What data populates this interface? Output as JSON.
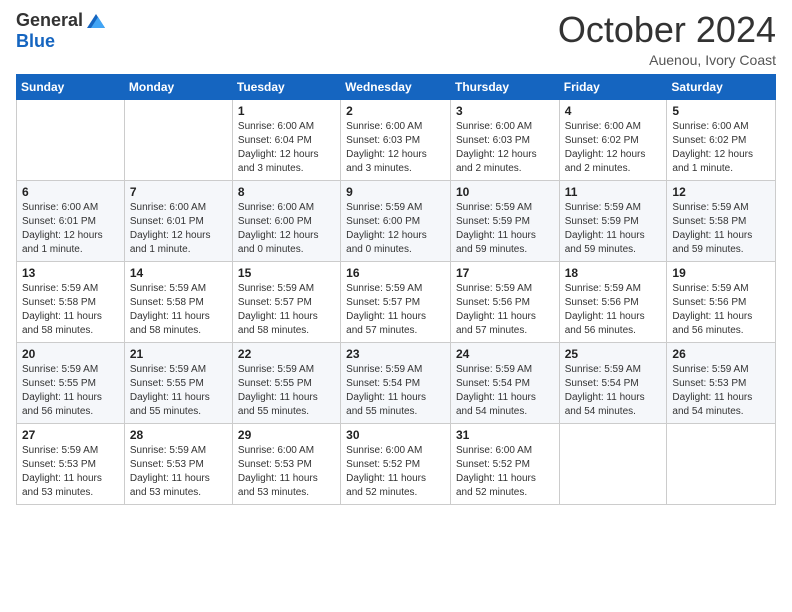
{
  "header": {
    "logo_general": "General",
    "logo_blue": "Blue",
    "month": "October 2024",
    "location": "Auenou, Ivory Coast"
  },
  "days_of_week": [
    "Sunday",
    "Monday",
    "Tuesday",
    "Wednesday",
    "Thursday",
    "Friday",
    "Saturday"
  ],
  "weeks": [
    [
      {
        "day": "",
        "info": ""
      },
      {
        "day": "",
        "info": ""
      },
      {
        "day": "1",
        "info": "Sunrise: 6:00 AM\nSunset: 6:04 PM\nDaylight: 12 hours\nand 3 minutes."
      },
      {
        "day": "2",
        "info": "Sunrise: 6:00 AM\nSunset: 6:03 PM\nDaylight: 12 hours\nand 3 minutes."
      },
      {
        "day": "3",
        "info": "Sunrise: 6:00 AM\nSunset: 6:03 PM\nDaylight: 12 hours\nand 2 minutes."
      },
      {
        "day": "4",
        "info": "Sunrise: 6:00 AM\nSunset: 6:02 PM\nDaylight: 12 hours\nand 2 minutes."
      },
      {
        "day": "5",
        "info": "Sunrise: 6:00 AM\nSunset: 6:02 PM\nDaylight: 12 hours\nand 1 minute."
      }
    ],
    [
      {
        "day": "6",
        "info": "Sunrise: 6:00 AM\nSunset: 6:01 PM\nDaylight: 12 hours\nand 1 minute."
      },
      {
        "day": "7",
        "info": "Sunrise: 6:00 AM\nSunset: 6:01 PM\nDaylight: 12 hours\nand 1 minute."
      },
      {
        "day": "8",
        "info": "Sunrise: 6:00 AM\nSunset: 6:00 PM\nDaylight: 12 hours\nand 0 minutes."
      },
      {
        "day": "9",
        "info": "Sunrise: 5:59 AM\nSunset: 6:00 PM\nDaylight: 12 hours\nand 0 minutes."
      },
      {
        "day": "10",
        "info": "Sunrise: 5:59 AM\nSunset: 5:59 PM\nDaylight: 11 hours\nand 59 minutes."
      },
      {
        "day": "11",
        "info": "Sunrise: 5:59 AM\nSunset: 5:59 PM\nDaylight: 11 hours\nand 59 minutes."
      },
      {
        "day": "12",
        "info": "Sunrise: 5:59 AM\nSunset: 5:58 PM\nDaylight: 11 hours\nand 59 minutes."
      }
    ],
    [
      {
        "day": "13",
        "info": "Sunrise: 5:59 AM\nSunset: 5:58 PM\nDaylight: 11 hours\nand 58 minutes."
      },
      {
        "day": "14",
        "info": "Sunrise: 5:59 AM\nSunset: 5:58 PM\nDaylight: 11 hours\nand 58 minutes."
      },
      {
        "day": "15",
        "info": "Sunrise: 5:59 AM\nSunset: 5:57 PM\nDaylight: 11 hours\nand 58 minutes."
      },
      {
        "day": "16",
        "info": "Sunrise: 5:59 AM\nSunset: 5:57 PM\nDaylight: 11 hours\nand 57 minutes."
      },
      {
        "day": "17",
        "info": "Sunrise: 5:59 AM\nSunset: 5:56 PM\nDaylight: 11 hours\nand 57 minutes."
      },
      {
        "day": "18",
        "info": "Sunrise: 5:59 AM\nSunset: 5:56 PM\nDaylight: 11 hours\nand 56 minutes."
      },
      {
        "day": "19",
        "info": "Sunrise: 5:59 AM\nSunset: 5:56 PM\nDaylight: 11 hours\nand 56 minutes."
      }
    ],
    [
      {
        "day": "20",
        "info": "Sunrise: 5:59 AM\nSunset: 5:55 PM\nDaylight: 11 hours\nand 56 minutes."
      },
      {
        "day": "21",
        "info": "Sunrise: 5:59 AM\nSunset: 5:55 PM\nDaylight: 11 hours\nand 55 minutes."
      },
      {
        "day": "22",
        "info": "Sunrise: 5:59 AM\nSunset: 5:55 PM\nDaylight: 11 hours\nand 55 minutes."
      },
      {
        "day": "23",
        "info": "Sunrise: 5:59 AM\nSunset: 5:54 PM\nDaylight: 11 hours\nand 55 minutes."
      },
      {
        "day": "24",
        "info": "Sunrise: 5:59 AM\nSunset: 5:54 PM\nDaylight: 11 hours\nand 54 minutes."
      },
      {
        "day": "25",
        "info": "Sunrise: 5:59 AM\nSunset: 5:54 PM\nDaylight: 11 hours\nand 54 minutes."
      },
      {
        "day": "26",
        "info": "Sunrise: 5:59 AM\nSunset: 5:53 PM\nDaylight: 11 hours\nand 54 minutes."
      }
    ],
    [
      {
        "day": "27",
        "info": "Sunrise: 5:59 AM\nSunset: 5:53 PM\nDaylight: 11 hours\nand 53 minutes."
      },
      {
        "day": "28",
        "info": "Sunrise: 5:59 AM\nSunset: 5:53 PM\nDaylight: 11 hours\nand 53 minutes."
      },
      {
        "day": "29",
        "info": "Sunrise: 6:00 AM\nSunset: 5:53 PM\nDaylight: 11 hours\nand 53 minutes."
      },
      {
        "day": "30",
        "info": "Sunrise: 6:00 AM\nSunset: 5:52 PM\nDaylight: 11 hours\nand 52 minutes."
      },
      {
        "day": "31",
        "info": "Sunrise: 6:00 AM\nSunset: 5:52 PM\nDaylight: 11 hours\nand 52 minutes."
      },
      {
        "day": "",
        "info": ""
      },
      {
        "day": "",
        "info": ""
      }
    ]
  ]
}
